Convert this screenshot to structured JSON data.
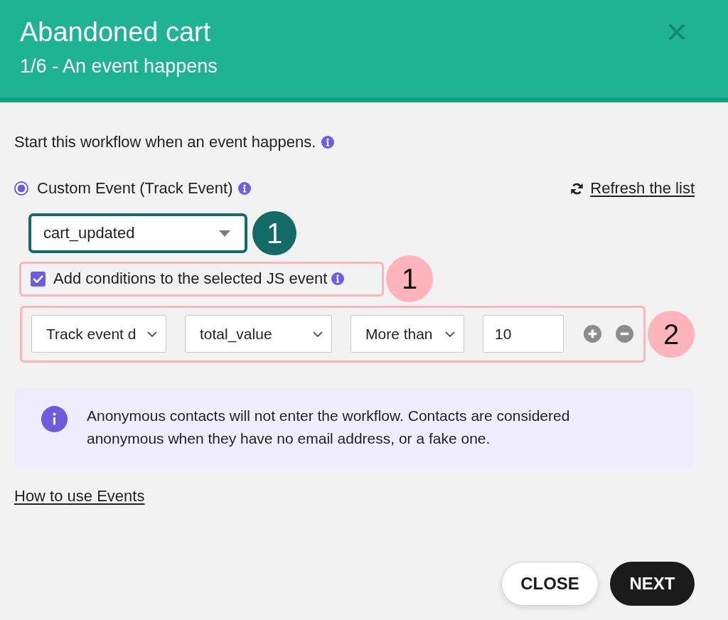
{
  "dialog": {
    "title": "Abandoned cart",
    "subtitle": "1/6 - An event happens"
  },
  "intro": {
    "text": "Start this workflow when an event happens."
  },
  "trigger": {
    "label": "Custom Event (Track Event)",
    "selected": true,
    "refresh_link": "Refresh the list"
  },
  "event_select": {
    "value": "cart_updated",
    "callout": {
      "label": "1",
      "color": "#136b67"
    }
  },
  "conditions_toggle": {
    "label": "Add conditions to the selected JS event",
    "checked": true,
    "callout": {
      "label": "1",
      "color": "#ffb3bb"
    }
  },
  "conditions": {
    "rows": [
      {
        "fields": [
          {
            "kind": "select",
            "value": "Track event d"
          },
          {
            "kind": "select",
            "value": "total_value"
          },
          {
            "kind": "select",
            "value": "More than"
          },
          {
            "kind": "input",
            "value": "10"
          }
        ]
      }
    ],
    "callout": {
      "label": "2",
      "color": "#ffb3bb"
    }
  },
  "notice": {
    "text": "Anonymous contacts will not enter the workflow. Contacts are considered anonymous when they have no email address, or a fake one."
  },
  "help_link": "How to use Events",
  "buttons": [
    {
      "label": "CLOSE",
      "kind": "secondary"
    },
    {
      "label": "NEXT",
      "kind": "primary"
    }
  ]
}
